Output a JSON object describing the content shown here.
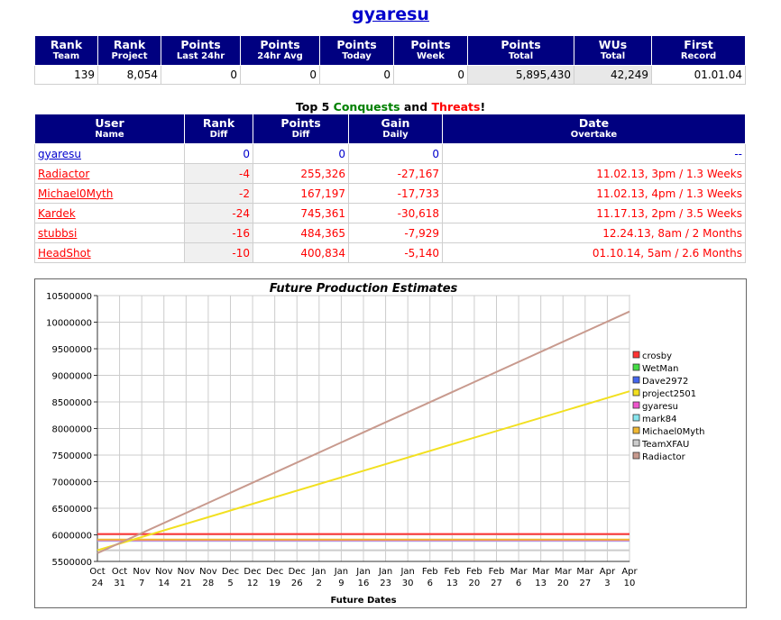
{
  "page": {
    "title": "gyaresu"
  },
  "stats": {
    "headers": [
      {
        "top": "Rank",
        "sub": "Team"
      },
      {
        "top": "Rank",
        "sub": "Project"
      },
      {
        "top": "Points",
        "sub": "Last 24hr"
      },
      {
        "top": "Points",
        "sub": "24hr Avg"
      },
      {
        "top": "Points",
        "sub": "Today"
      },
      {
        "top": "Points",
        "sub": "Week"
      },
      {
        "top": "Points",
        "sub": "Total"
      },
      {
        "top": "WUs",
        "sub": "Total"
      },
      {
        "top": "First",
        "sub": "Record"
      }
    ],
    "values": [
      "139",
      "8,054",
      "0",
      "0",
      "0",
      "0",
      "5,895,430",
      "42,249",
      "01.01.04"
    ]
  },
  "top5": {
    "prefix": "Top 5 ",
    "conquests": "Conquests",
    "and": " and ",
    "threats": "Threats",
    "suffix": "!"
  },
  "threats": {
    "headers": [
      {
        "top": "User",
        "sub": "Name"
      },
      {
        "top": "Rank",
        "sub": "Diff"
      },
      {
        "top": "Points",
        "sub": "Diff"
      },
      {
        "top": "Gain",
        "sub": "Daily"
      },
      {
        "top": "Date",
        "sub": "Overtake"
      }
    ],
    "rows": [
      {
        "name": "gyaresu",
        "rank": "0",
        "points": "0",
        "gain": "0",
        "date": "--"
      },
      {
        "name": "Radiactor",
        "rank": "-4",
        "points": "255,326",
        "gain": "-27,167",
        "date": "11.02.13, 3pm / 1.3 Weeks"
      },
      {
        "name": "Michael0Myth",
        "rank": "-2",
        "points": "167,197",
        "gain": "-17,733",
        "date": "11.02.13, 4pm / 1.3 Weeks"
      },
      {
        "name": "Kardek",
        "rank": "-24",
        "points": "745,361",
        "gain": "-30,618",
        "date": "11.17.13, 2pm / 3.5 Weeks"
      },
      {
        "name": "stubbsi",
        "rank": "-16",
        "points": "484,365",
        "gain": "-7,929",
        "date": "12.24.13, 8am / 2 Months"
      },
      {
        "name": "HeadShot",
        "rank": "-10",
        "points": "400,834",
        "gain": "-5,140",
        "date": "01.10.14, 5am / 2.6 Months"
      }
    ]
  },
  "chart_data": {
    "type": "line",
    "title": "Future Production Estimates",
    "xlabel": "Future Dates",
    "ylabel": "",
    "ylim": [
      5500000,
      10500000
    ],
    "yticks": [
      5500000,
      6000000,
      6500000,
      7000000,
      7500000,
      8000000,
      8500000,
      9000000,
      9500000,
      10000000,
      10500000
    ],
    "x": [
      [
        "Oct",
        "24"
      ],
      [
        "Oct",
        "31"
      ],
      [
        "Nov",
        "7"
      ],
      [
        "Nov",
        "14"
      ],
      [
        "Nov",
        "21"
      ],
      [
        "Nov",
        "28"
      ],
      [
        "Dec",
        "5"
      ],
      [
        "Dec",
        "12"
      ],
      [
        "Dec",
        "19"
      ],
      [
        "Dec",
        "26"
      ],
      [
        "Jan",
        "2"
      ],
      [
        "Jan",
        "9"
      ],
      [
        "Jan",
        "16"
      ],
      [
        "Jan",
        "23"
      ],
      [
        "Jan",
        "30"
      ],
      [
        "Feb",
        "6"
      ],
      [
        "Feb",
        "13"
      ],
      [
        "Feb",
        "20"
      ],
      [
        "Feb",
        "27"
      ],
      [
        "Mar",
        "6"
      ],
      [
        "Mar",
        "13"
      ],
      [
        "Mar",
        "20"
      ],
      [
        "Mar",
        "27"
      ],
      [
        "Apr",
        "3"
      ],
      [
        "Apr",
        "10"
      ]
    ],
    "grid": true,
    "legend": "right",
    "series": [
      {
        "name": "crosby",
        "color": "#ff3333",
        "start": 6015000,
        "end": 6015000
      },
      {
        "name": "WetMan",
        "color": "#44dd44",
        "start": 5905000,
        "end": 5905000
      },
      {
        "name": "Dave2972",
        "color": "#4466ee",
        "start": 5900000,
        "end": 5900000
      },
      {
        "name": "project2501",
        "color": "#f2e020",
        "start": 5710000,
        "end": 8700000
      },
      {
        "name": "gyaresu",
        "color": "#ee55cc",
        "start": 5895430,
        "end": 5895430
      },
      {
        "name": "mark84",
        "color": "#88e6ee",
        "start": 5885000,
        "end": 5885000
      },
      {
        "name": "Michael0Myth",
        "color": "#f0b833",
        "start": 5910000,
        "end": 5910000
      },
      {
        "name": "TeamXFAU",
        "color": "#cccccc",
        "start": 5710000,
        "end": 5710000
      },
      {
        "name": "Radiactor",
        "color": "#c89a8e",
        "start": 5655000,
        "end": 10200000
      }
    ]
  }
}
